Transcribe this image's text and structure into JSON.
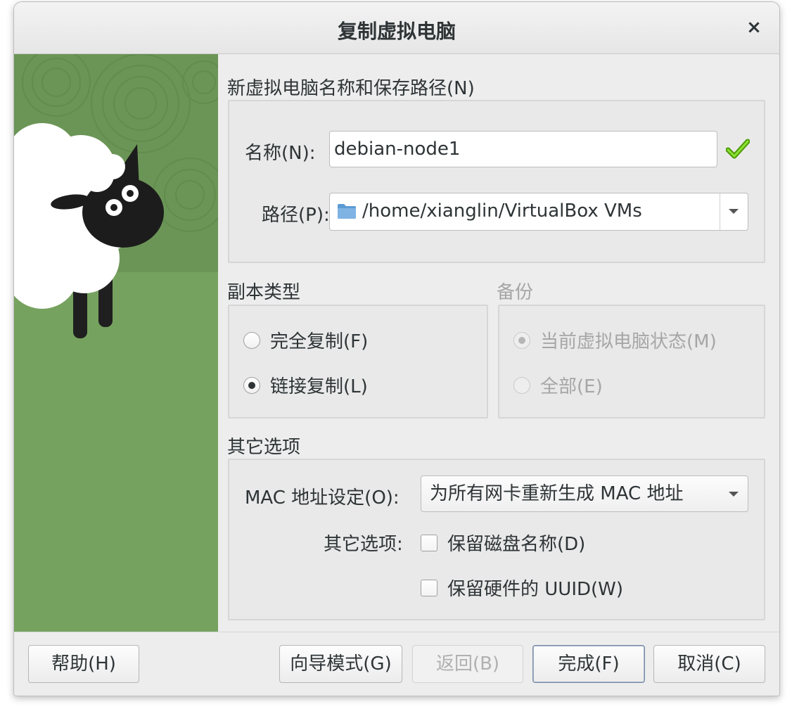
{
  "window": {
    "title": "复制虚拟电脑",
    "close_glyph": "×"
  },
  "name_section": {
    "title": "新虚拟电脑名称和保存路径(N)",
    "name_label": "名称(N):",
    "name_value": "debian-node1",
    "path_label": "路径(P):",
    "path_value": "/home/xianglin/VirtualBox VMs"
  },
  "clone_type": {
    "title": "副本类型",
    "options": [
      {
        "label": "完全复制(F)",
        "checked": false
      },
      {
        "label": "链接复制(L)",
        "checked": true
      }
    ]
  },
  "snapshots": {
    "title": "备份",
    "options": [
      {
        "label": "当前虚拟电脑状态(M)",
        "checked": true,
        "disabled": true
      },
      {
        "label": "全部(E)",
        "checked": false,
        "disabled": true
      }
    ]
  },
  "other_options": {
    "title": "其它选项",
    "mac_label": "MAC 地址设定(O):",
    "mac_value": "为所有网卡重新生成 MAC 地址",
    "additional_label": "其它选项:",
    "keep_disk_names": "保留磁盘名称(D)",
    "keep_hw_uuids": "保留硬件的 UUID(W)"
  },
  "buttons": {
    "help": "帮助(H)",
    "guided_mode": "向导模式(G)",
    "back": "返回(B)",
    "finish": "完成(F)",
    "cancel": "取消(C)"
  }
}
